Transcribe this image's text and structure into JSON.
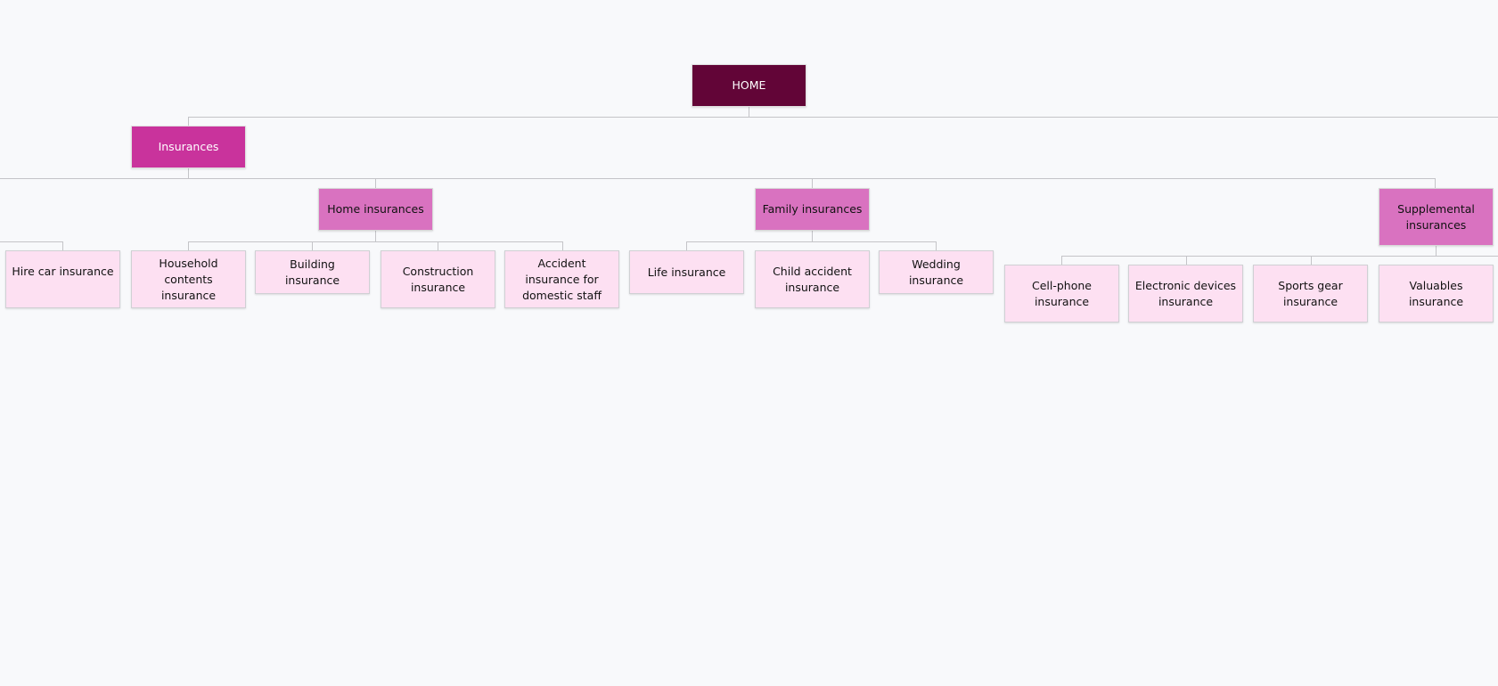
{
  "root": {
    "label": "HOME"
  },
  "level1": {
    "label": "Insurances"
  },
  "groups": {
    "home": {
      "label": "Home insurances"
    },
    "family": {
      "label": "Family insurances"
    },
    "supplemental": {
      "label": "Supplemental insurances"
    }
  },
  "leaves": {
    "hire_car": "Hire car insurance",
    "household": "Household contents insurance",
    "building": "Building insurance",
    "construction": "Construction insurance",
    "accident_staff": "Accident insurance for domestic staff",
    "life": "Life insurance",
    "child_accident": "Child accident insurance",
    "wedding": "Wedding insurance",
    "cellphone": "Cell-phone insurance",
    "electronic": "Electronic devices insurance",
    "sports": "Sports gear insurance",
    "valuables": "Valuables insurance"
  },
  "colors": {
    "root": "#620537",
    "level1": "#c9339c",
    "group": "#d972c0",
    "leaf": "#fde0f2",
    "background": "#f8f9fb",
    "connector": "#c4c4c8"
  }
}
